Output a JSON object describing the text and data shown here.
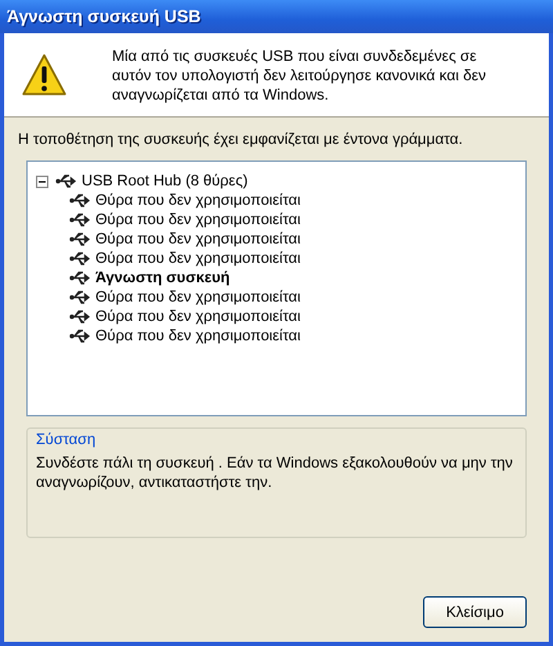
{
  "window": {
    "title": "Άγνωστη συσκευή USB"
  },
  "message": "Μία από τις συσκευές USB που είναι συνδεδεμένες σε αυτόν τον υπολογιστή δεν λειτούργησε κανονικά και δεν αναγνωρίζεται από τα Windows.",
  "hint": "Η τοποθέτηση της συσκευής έχει εμφανίζεται με έντονα γράμματα.",
  "tree": [
    {
      "label": "USB Root Hub (8 θύρες)",
      "expanded": true,
      "children": [
        {
          "label": "Θύρα που δεν χρησιμοποιείται",
          "bold": false
        },
        {
          "label": "Θύρα που δεν χρησιμοποιείται",
          "bold": false
        },
        {
          "label": "Θύρα που δεν χρησιμοποιείται",
          "bold": false
        },
        {
          "label": "Θύρα που δεν χρησιμοποιείται",
          "bold": false
        },
        {
          "label": "Άγνωστη συσκευή",
          "bold": true
        },
        {
          "label": "Θύρα που δεν χρησιμοποιείται",
          "bold": false
        },
        {
          "label": "Θύρα που δεν χρησιμοποιείται",
          "bold": false
        },
        {
          "label": "Θύρα που δεν χρησιμοποιείται",
          "bold": false
        }
      ]
    }
  ],
  "recommendation": {
    "title": "Σύσταση",
    "text": "Συνδέστε πάλι τη συσκευή . Εάν τα Windows εξακολουθούν να μην την αναγνωρίζουν, αντικαταστήστε την."
  },
  "buttons": [
    "Κλείσιμο"
  ]
}
